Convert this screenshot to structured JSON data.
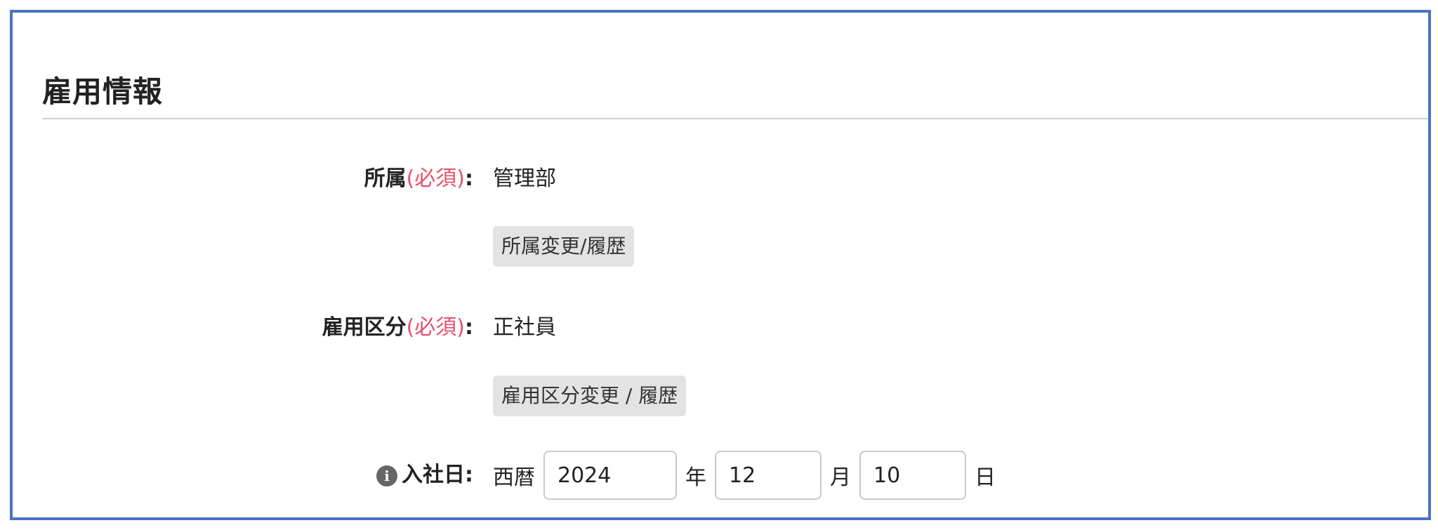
{
  "section": {
    "title": "雇用情報"
  },
  "affiliation": {
    "label": "所属",
    "required": "(必須)",
    "colon": ":",
    "value": "管理部",
    "button_label": "所属変更/履歴"
  },
  "employment_type": {
    "label": "雇用区分",
    "required": "(必須)",
    "colon": ":",
    "value": "正社員",
    "button_label": "雇用区分変更 / 履歴"
  },
  "hire_date": {
    "info_icon": "info-icon",
    "info_glyph": "i",
    "label": "入社日",
    "colon": ":",
    "era_prefix": "西暦",
    "year": "2024",
    "year_unit": "年",
    "month": "12",
    "month_unit": "月",
    "day": "10",
    "day_unit": "日"
  },
  "colors": {
    "frame_border": "#4a74c4",
    "required_text": "#e8506a",
    "button_bg": "#e3e3e3"
  }
}
